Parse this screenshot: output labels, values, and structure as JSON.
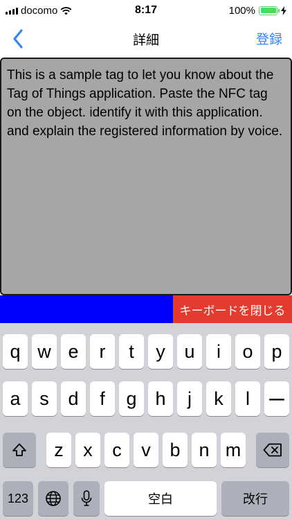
{
  "status_bar": {
    "carrier": "docomo",
    "time": "8:17",
    "battery_percent": "100%",
    "icons": [
      "signal-icon",
      "wifi-icon",
      "battery-icon",
      "charging-icon"
    ]
  },
  "nav": {
    "title": "詳細",
    "action_label": "登録",
    "back_icon": "chevron-left-icon",
    "accent_color": "#2f86f5"
  },
  "text_area": {
    "content": "This is a sample tag to let you know about the Tag of Things application. Paste the NFC tag on the object. identify it with this application. and explain the registered information by voice."
  },
  "accessory": {
    "close_keyboard_label": "キーボードを閉じる",
    "close_color": "#e53b2e",
    "bar_color": "#0000ff"
  },
  "keyboard": {
    "row1": [
      "q",
      "w",
      "e",
      "r",
      "t",
      "y",
      "u",
      "i",
      "o",
      "p"
    ],
    "row2": [
      "a",
      "s",
      "d",
      "f",
      "g",
      "h",
      "j",
      "k",
      "l",
      "ー"
    ],
    "row3": [
      "z",
      "x",
      "c",
      "v",
      "b",
      "n",
      "m"
    ],
    "numbers_label": "123",
    "space_label": "空白",
    "return_label": "改行",
    "special_icons": [
      "shift-icon",
      "backspace-icon",
      "globe-icon",
      "microphone-icon"
    ]
  }
}
